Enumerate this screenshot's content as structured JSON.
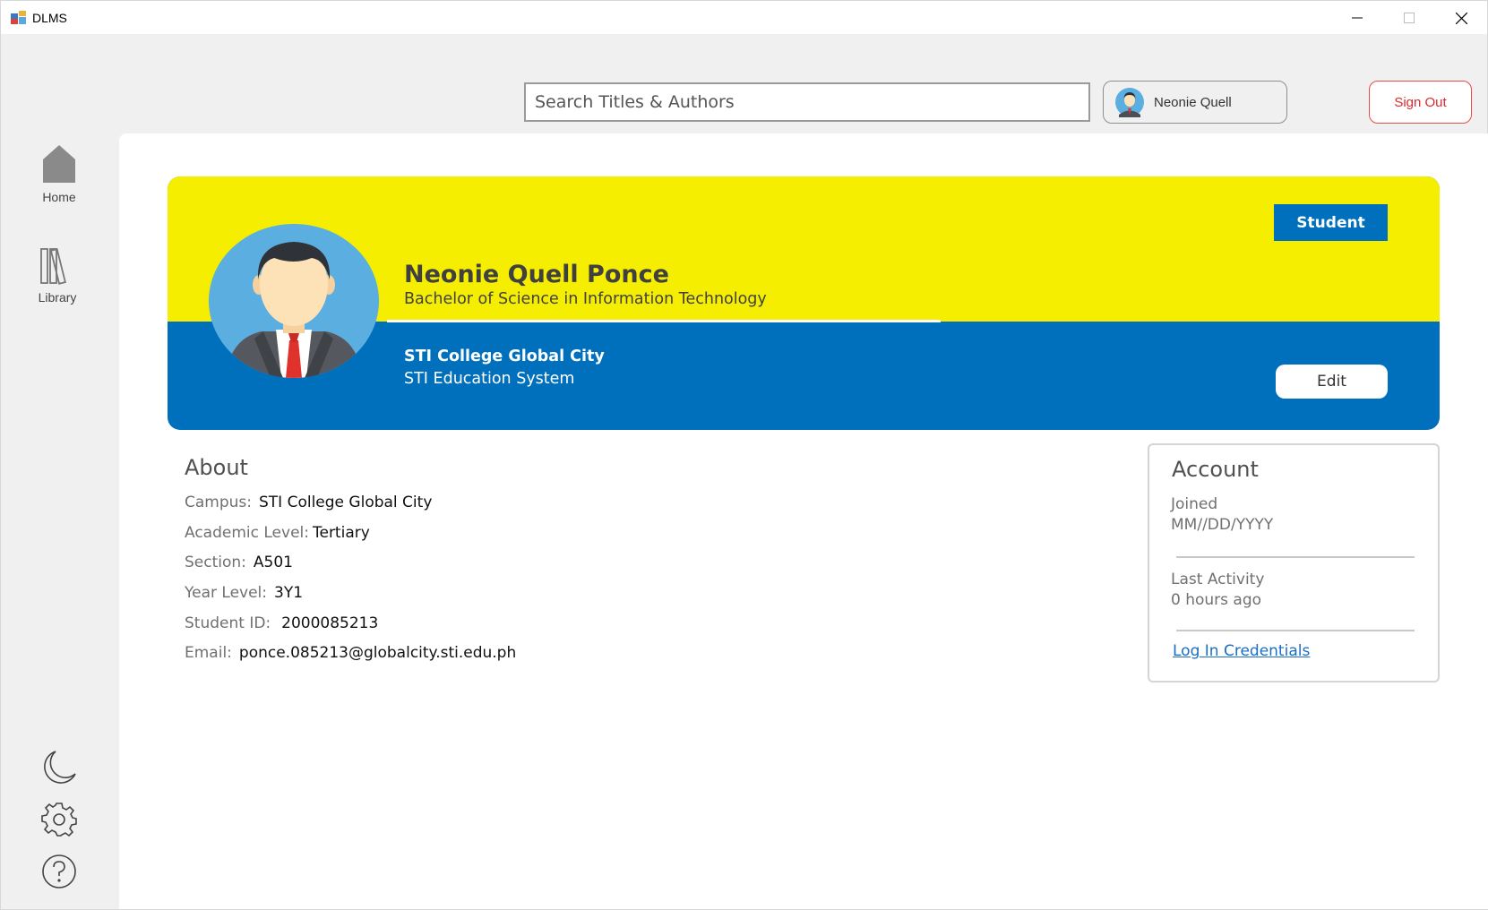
{
  "window": {
    "title": "DLMS",
    "icons": [
      "app-icon",
      "minimize-icon",
      "maximize-icon",
      "close-icon"
    ]
  },
  "header": {
    "search_placeholder": "Search Titles & Authors",
    "user_name": "Neonie Quell",
    "sign_out_label": "Sign Out"
  },
  "sidebar": {
    "items": [
      {
        "label": "Home",
        "icon": "home-icon"
      },
      {
        "label": "Library",
        "icon": "library-icon"
      }
    ],
    "bottom_icons": [
      "moon-icon",
      "gear-icon",
      "help-icon"
    ]
  },
  "profile": {
    "role": "Student",
    "full_name": "Neonie Quell Ponce",
    "program": "Bachelor of Science in Information Technology",
    "school": "STI College Global City",
    "system": "STI Education System",
    "edit_label": "Edit"
  },
  "about": {
    "title": "About",
    "rows": [
      {
        "label": "Campus:",
        "value": "STI College Global City"
      },
      {
        "label": "Academic Level:",
        "value": "Tertiary"
      },
      {
        "label": "Section:",
        "value": "A501"
      },
      {
        "label": "Year Level:",
        "value": "3Y1"
      },
      {
        "label": "Student ID:",
        "value": "2000085213"
      },
      {
        "label": "Email:",
        "value": "ponce.085213@globalcity.sti.edu.ph"
      }
    ]
  },
  "account": {
    "title": "Account",
    "joined_label": "Joined",
    "joined_value": "MM//DD/YYYY",
    "activity_label": "Last Activity",
    "activity_value": "0 hours ago",
    "credentials_link": "Log In Credentials"
  },
  "colors": {
    "banner_yellow": "#f6ee00",
    "banner_blue": "#0070bd",
    "sign_out_red": "#e0282c",
    "link_blue": "#1a6fc0"
  }
}
